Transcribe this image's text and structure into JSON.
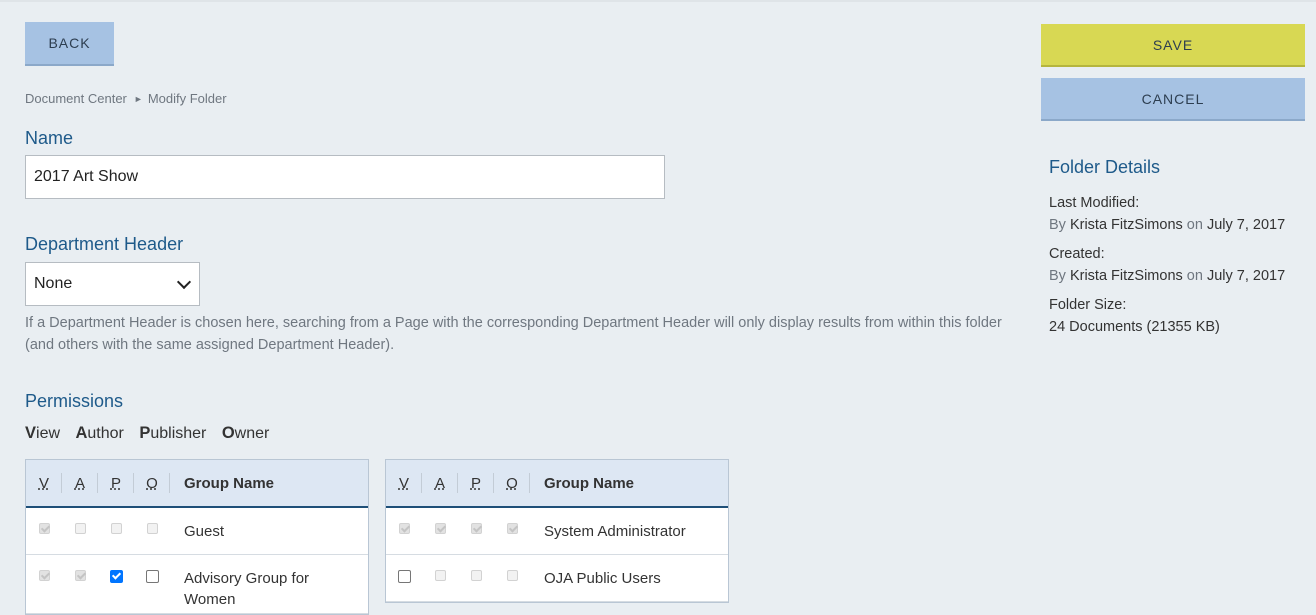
{
  "header": {
    "back_label": "BACK",
    "save_label": "SAVE",
    "cancel_label": "CANCEL"
  },
  "breadcrumb": {
    "root": "Document Center",
    "separator": "►",
    "current": "Modify Folder"
  },
  "form": {
    "name_label": "Name",
    "name_value": "2017 Art Show",
    "dept_label": "Department Header",
    "dept_value": "None",
    "dept_help": "If a Department Header is chosen here, searching from a Page with the corresponding Department Header will only display results from within this folder (and others with the same assigned Department Header)."
  },
  "permissions": {
    "title": "Permissions",
    "legend": [
      {
        "key": "V",
        "rest": "iew"
      },
      {
        "key": "A",
        "rest": "uthor"
      },
      {
        "key": "P",
        "rest": "ublisher"
      },
      {
        "key": "O",
        "rest": "wner"
      }
    ],
    "columns": [
      "V",
      "A",
      "P",
      "O",
      "Group Name"
    ],
    "left_rows": [
      {
        "group": "Guest",
        "v": {
          "checked": true,
          "disabled": true
        },
        "a": {
          "checked": false,
          "disabled": true
        },
        "p": {
          "checked": false,
          "disabled": true
        },
        "o": {
          "checked": false,
          "disabled": true
        }
      },
      {
        "group": "Advisory Group for Women",
        "v": {
          "checked": true,
          "disabled": true
        },
        "a": {
          "checked": true,
          "disabled": true
        },
        "p": {
          "checked": true,
          "disabled": false
        },
        "o": {
          "checked": false,
          "disabled": false
        }
      }
    ],
    "right_rows": [
      {
        "group": "System Administrator",
        "v": {
          "checked": true,
          "disabled": true
        },
        "a": {
          "checked": true,
          "disabled": true
        },
        "p": {
          "checked": true,
          "disabled": true
        },
        "o": {
          "checked": true,
          "disabled": true
        }
      },
      {
        "group": "OJA Public Users",
        "v": {
          "checked": false,
          "disabled": false
        },
        "a": {
          "checked": false,
          "disabled": true
        },
        "p": {
          "checked": false,
          "disabled": true
        },
        "o": {
          "checked": false,
          "disabled": true
        }
      }
    ]
  },
  "folder_details": {
    "title": "Folder Details",
    "last_modified_label": "Last Modified:",
    "last_modified_by_prefix": "By",
    "last_modified_by": "Krista FitzSimons",
    "last_modified_on_prefix": "on",
    "last_modified_date": "July 7, 2017",
    "created_label": "Created:",
    "created_by_prefix": "By",
    "created_by": "Krista FitzSimons",
    "created_on_prefix": "on",
    "created_date": "July 7, 2017",
    "size_label": "Folder Size:",
    "size_value": "24 Documents (21355 KB)"
  },
  "colors": {
    "background": "#e9eef2",
    "save_button": "#d8d853",
    "secondary_button": "#a6c2e3",
    "heading": "#1e5a8a"
  }
}
